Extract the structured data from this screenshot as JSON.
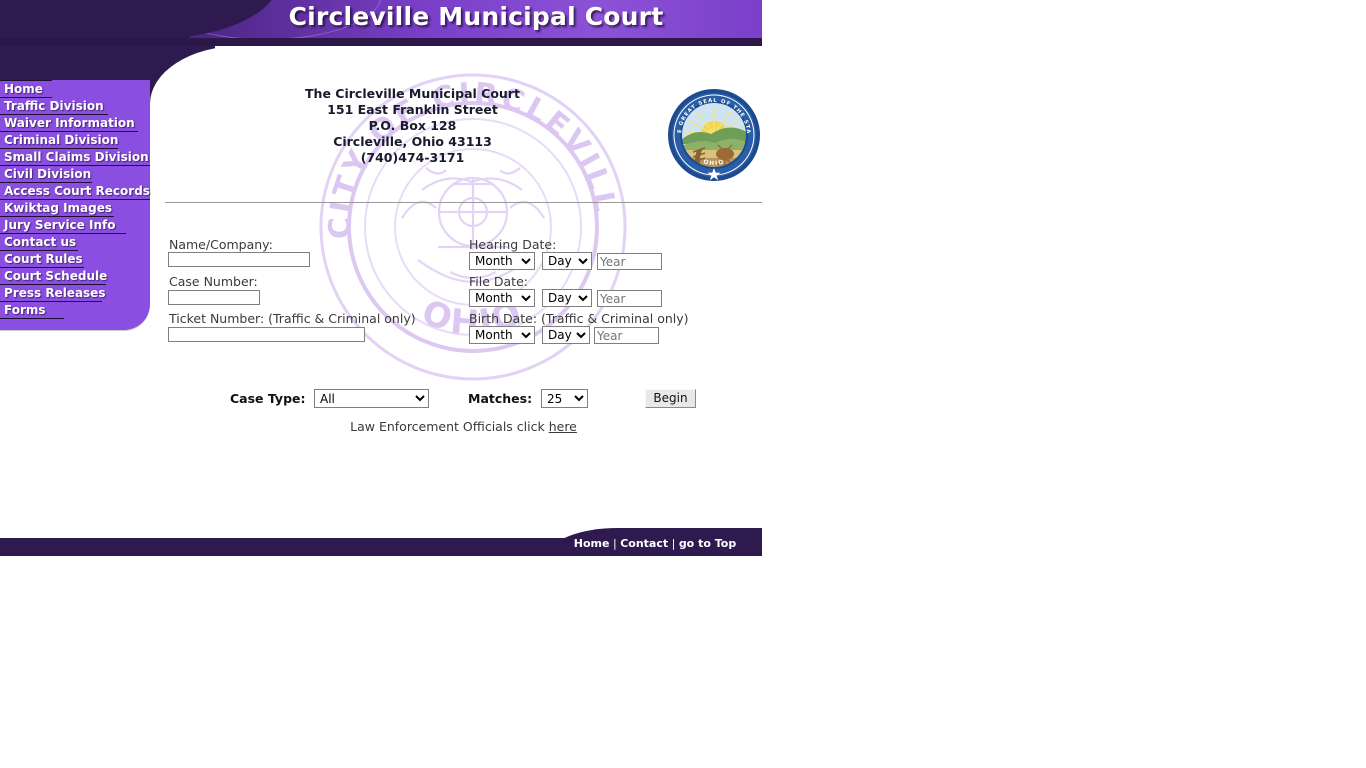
{
  "header": {
    "title": "Circleville Municipal Court"
  },
  "sidebar": {
    "items": [
      {
        "label": "Home"
      },
      {
        "label": "Traffic Division"
      },
      {
        "label": "Waiver Information"
      },
      {
        "label": "Criminal Division"
      },
      {
        "label": "Small Claims Division"
      },
      {
        "label": "Civil Division"
      },
      {
        "label": "Access Court Records"
      },
      {
        "label": "Kwiktag Images"
      },
      {
        "label": "Jury Service Info"
      },
      {
        "label": "Contact us"
      },
      {
        "label": "Court Rules"
      },
      {
        "label": "Court Schedule"
      },
      {
        "label": "Press Releases"
      },
      {
        "label": "Forms"
      }
    ]
  },
  "address": {
    "line1": "The Circleville Municipal Court",
    "line2": "151 East Franklin Street",
    "line3": "P.O. Box 128",
    "line4": "Circleville, Ohio 43113",
    "line5": "(740)474-3171"
  },
  "seal": {
    "name": "ohio-state-seal",
    "text_top": "THE GREAT SEAL OF THE STATE",
    "text_bottom": "OHIO"
  },
  "watermark": {
    "text_top": "CITY OF CIRCLEVILLE",
    "text_bottom": "OHIO"
  },
  "form": {
    "name_label": "Name/Company:",
    "name_value": "",
    "name_placeholder": "",
    "case_label": "Case Number:",
    "case_value": "",
    "ticket_label": "Ticket Number: (Traffic & Criminal only)",
    "ticket_value": "",
    "hearing_label": "Hearing Date:",
    "file_label": "File Date:",
    "birth_label": "Birth Date: (Traffic & Criminal only)",
    "month_option": "Month",
    "day_option": "Day",
    "year_placeholder": "Year",
    "year_value": "",
    "case_type_label": "Case Type:",
    "case_type_value": "All",
    "case_type_options": [
      "All"
    ],
    "matches_label": "Matches:",
    "matches_value": "25",
    "matches_options": [
      "25"
    ],
    "begin_label": "Begin",
    "leo_text": "Law Enforcement Officials click ",
    "leo_link": "here"
  },
  "footer": {
    "home": "Home",
    "sep1": " | ",
    "contact": "Contact",
    "sep2": " | ",
    "top": "go to Top"
  },
  "colors": {
    "dark_purple": "#2e1a4f",
    "banner_purple": "#7b3fc9",
    "nav_purple": "#8a4ee0",
    "watermark_purple": "#ddc8f2"
  }
}
